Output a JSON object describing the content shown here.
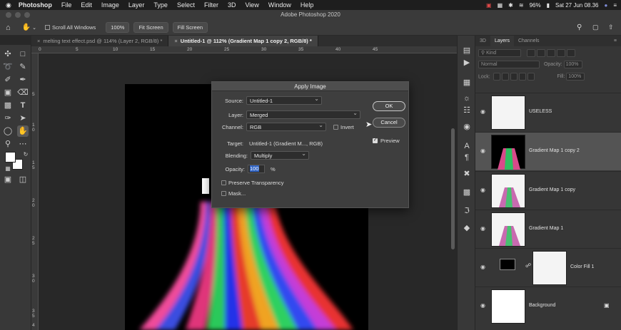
{
  "menubar": {
    "app": "Photoshop",
    "items": [
      "File",
      "Edit",
      "Image",
      "Layer",
      "Type",
      "Select",
      "Filter",
      "3D",
      "View",
      "Window",
      "Help"
    ],
    "battery": "96%",
    "datetime": "Sat 27 Jun  08.36"
  },
  "window_title": "Adobe Photoshop 2020",
  "options": {
    "scroll_all_windows": "Scroll All Windows",
    "zoom": "100%",
    "fit_screen": "Fit Screen",
    "fill_screen": "Fill Screen"
  },
  "tabs": [
    {
      "label": "melting text effect.psd @ 114% (Layer 2, RGB/8) *",
      "active": false
    },
    {
      "label": "Untitled-1 @ 112% (Gradient Map 1 copy 2, RGB/8) *",
      "active": true
    }
  ],
  "ruler": {
    "top_ticks": [
      "0",
      "5",
      "10",
      "15",
      "20",
      "25",
      "30",
      "35",
      "40",
      "45"
    ],
    "left_ticks": [
      "5",
      "1 0",
      "1 5",
      "2 0",
      "2 5",
      "3 0",
      "3 5",
      "4"
    ]
  },
  "dialog": {
    "title": "Apply Image",
    "source_label": "Source:",
    "source_value": "Untitled-1",
    "layer_label": "Layer:",
    "layer_value": "Merged",
    "channel_label": "Channel:",
    "channel_value": "RGB",
    "invert_label": "Invert",
    "target_label": "Target:",
    "target_value": "Untitled-1 (Gradient M..., RGB)",
    "blending_label": "Blending:",
    "blending_value": "Multiply",
    "opacity_label": "Opacity:",
    "opacity_value": "100",
    "opacity_unit": "%",
    "preserve_label": "Preserve Transparency",
    "mask_label": "Mask...",
    "ok_label": "OK",
    "cancel_label": "Cancel",
    "preview_label": "Preview",
    "preview_checked": true
  },
  "layers_panel": {
    "tabs": [
      "3D",
      "Layers",
      "Channels"
    ],
    "active_tab": "Layers",
    "kind_label": "Kind",
    "blend_mode": "Normal",
    "opacity_label": "Opacity:",
    "opacity_value": "100%",
    "lock_label": "Lock:",
    "fill_label": "Fill:",
    "fill_value": "100%",
    "layers": [
      {
        "name": "USELESS",
        "selected": false
      },
      {
        "name": "Gradient Map 1 copy 2",
        "selected": true
      },
      {
        "name": "Gradient Map 1 copy",
        "selected": false
      },
      {
        "name": "Gradient Map 1",
        "selected": false
      },
      {
        "name": "Color Fill 1",
        "selected": false
      },
      {
        "name": "Background",
        "selected": false
      }
    ]
  },
  "colors": {
    "accent": "#3d7ad6",
    "panel": "#363636",
    "selected_layer": "#545454"
  }
}
